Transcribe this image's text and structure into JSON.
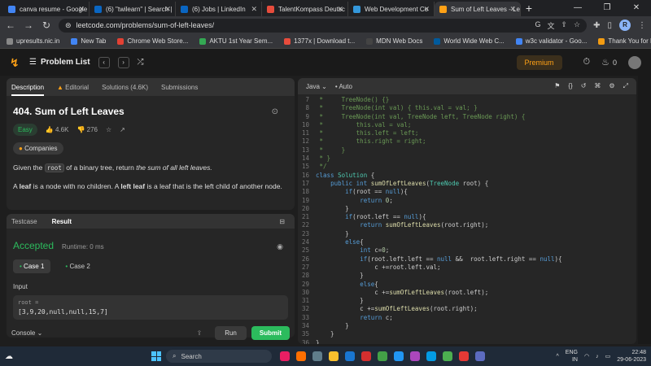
{
  "browser": {
    "tabs": [
      {
        "label": "canva resume - Google",
        "color": "#4285f4"
      },
      {
        "label": "(6) \"twilearn\" | Search |",
        "color": "#0a66c2"
      },
      {
        "label": "(6) Jobs | LinkedIn",
        "color": "#0a66c2"
      },
      {
        "label": "TalentKompass Deutsc",
        "color": "#e74c3c"
      },
      {
        "label": "Web Development Co",
        "color": "#3498db"
      },
      {
        "label": "Sum of Left Leaves - Le",
        "color": "#ffa116",
        "active": true
      }
    ],
    "url": "leetcode.com/problems/sum-of-left-leaves/",
    "profile_initial": "R",
    "bookmarks": [
      {
        "label": "upresults.nic.in",
        "color": "#888"
      },
      {
        "label": "New Tab",
        "color": "#4285f4"
      },
      {
        "label": "Chrome Web Store...",
        "color": "#e34133"
      },
      {
        "label": "AKTU 1st Year Sem...",
        "color": "#34a853"
      },
      {
        "label": "1377x | Download t...",
        "color": "#e74c3c"
      },
      {
        "label": "MDN Web Docs",
        "color": "#444"
      },
      {
        "label": "World Wide Web C...",
        "color": "#005a9c"
      },
      {
        "label": "w3c validator - Goo...",
        "color": "#4285f4"
      },
      {
        "label": "Thank You for Dow...",
        "color": "#f39c12"
      }
    ]
  },
  "header": {
    "problem_list": "Problem List",
    "premium": "Premium",
    "streak": "0"
  },
  "desc": {
    "tabs": [
      "Description",
      "Editorial",
      "Solutions (4.6K)",
      "Submissions"
    ],
    "title": "404. Sum of Left Leaves",
    "difficulty": "Easy",
    "likes": "4.6K",
    "dislikes": "276",
    "companies": "Companies",
    "p1_pre": "Given the",
    "p1_code": "root",
    "p1_mid": "of a binary tree, return",
    "p1_em": "the sum of all left leaves.",
    "p2_a": "A",
    "p2_b": "leaf",
    "p2_c": "is a node with no children. A",
    "p2_d": "left leaf",
    "p2_e": "is a leaf that is the left child of another node."
  },
  "test": {
    "tabs": [
      "Testcase",
      "Result"
    ],
    "status": "Accepted",
    "runtime": "Runtime: 0 ms",
    "cases": [
      "Case 1",
      "Case 2"
    ],
    "input_label": "Input",
    "var": "root =",
    "value": "[3,9,20,null,null,15,7]",
    "console": "Console",
    "run": "Run",
    "submit": "Submit"
  },
  "editor": {
    "language": "Java",
    "mode": "Auto",
    "lines": [
      {
        "n": "7",
        "html": "<span class='cm'> *     TreeNode() {}</span>"
      },
      {
        "n": "8",
        "html": "<span class='cm'> *     TreeNode(int val) { this.val = val; }</span>"
      },
      {
        "n": "9",
        "html": "<span class='cm'> *     TreeNode(int val, TreeNode left, TreeNode right) {</span>"
      },
      {
        "n": "10",
        "html": "<span class='cm'> *         this.val = val;</span>"
      },
      {
        "n": "11",
        "html": "<span class='cm'> *         this.left = left;</span>"
      },
      {
        "n": "12",
        "html": "<span class='cm'> *         this.right = right;</span>"
      },
      {
        "n": "13",
        "html": "<span class='cm'> *     }</span>"
      },
      {
        "n": "14",
        "html": "<span class='cm'> * }</span>"
      },
      {
        "n": "15",
        "html": "<span class='cm'> */</span>"
      },
      {
        "n": "16",
        "html": "<span class='kw'>class</span> <span class='ty'>Solution</span> {"
      },
      {
        "n": "17",
        "html": "    <span class='kw'>public</span> <span class='kw'>int</span> <span class='fn'>sumOfLeftLeaves</span>(<span class='ty'>TreeNode</span> root) {"
      },
      {
        "n": "18",
        "html": "        <span class='kw'>if</span>(root == <span class='nl'>null</span>){"
      },
      {
        "n": "19",
        "html": "            <span class='kw'>return</span> <span class='nu'>0</span>;"
      },
      {
        "n": "20",
        "html": "        }"
      },
      {
        "n": "21",
        "html": "        <span class='kw'>if</span>(root.left == <span class='nl'>null</span>){"
      },
      {
        "n": "22",
        "html": "            <span class='kw'>return</span> <span class='fn'>sumOfLeftLeaves</span>(root.right);"
      },
      {
        "n": "23",
        "html": "        }"
      },
      {
        "n": "24",
        "html": "        <span class='kw'>else</span>{"
      },
      {
        "n": "25",
        "html": "            <span class='kw'>int</span> c=<span class='nu'>0</span>;"
      },
      {
        "n": "26",
        "html": "            <span class='kw'>if</span>(root.left.left == <span class='nl'>null</span> &&  root.left.right == <span class='nl'>null</span>){"
      },
      {
        "n": "27",
        "html": "                c +=root.left.val;"
      },
      {
        "n": "28",
        "html": "            }"
      },
      {
        "n": "29",
        "html": "            <span class='kw'>else</span>{"
      },
      {
        "n": "30",
        "html": "                c +=<span class='fn'>sumOfLeftLeaves</span>(root.left);"
      },
      {
        "n": "31",
        "html": "            }"
      },
      {
        "n": "32",
        "html": "            c +=<span class='fn'>sumOfLeftLeaves</span>(root.right);"
      },
      {
        "n": "33",
        "html": "            <span class='kw'>return</span> c;"
      },
      {
        "n": "34",
        "html": "        }"
      },
      {
        "n": "35",
        "html": "    }"
      },
      {
        "n": "36",
        "html": "}"
      }
    ]
  },
  "taskbar": {
    "search": "Search",
    "lang": "ENG",
    "region": "IN",
    "time": "22:48",
    "date": "29-06-2023"
  }
}
